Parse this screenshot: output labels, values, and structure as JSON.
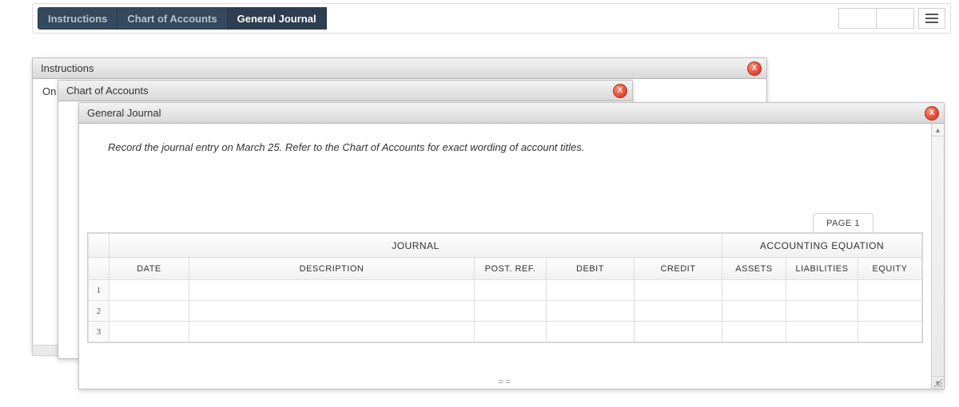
{
  "toolbar": {
    "tabs": [
      {
        "label": "Instructions",
        "active": false
      },
      {
        "label": "Chart of Accounts",
        "active": false
      },
      {
        "label": "General Journal",
        "active": true
      }
    ]
  },
  "panels": {
    "instructions": {
      "title": "Instructions",
      "body_prefix": "On"
    },
    "chart": {
      "title": "Chart of Accounts"
    },
    "journal": {
      "title": "General Journal"
    }
  },
  "journal": {
    "instruction": "Record the journal entry on March 25. Refer to the Chart of Accounts for exact wording of account titles.",
    "page_label": "PAGE 1",
    "group_headers": {
      "journal": "JOURNAL",
      "equation": "ACCOUNTING EQUATION"
    },
    "columns": {
      "date": "DATE",
      "description": "DESCRIPTION",
      "post_ref": "POST. REF.",
      "debit": "DEBIT",
      "credit": "CREDIT",
      "assets": "ASSETS",
      "liabilities": "LIABILITIES",
      "equity": "EQUITY"
    },
    "rows": [
      {
        "n": "1",
        "date": "",
        "description": "",
        "post_ref": "",
        "debit": "",
        "credit": "",
        "assets": "",
        "liabilities": "",
        "equity": ""
      },
      {
        "n": "2",
        "date": "",
        "description": "",
        "post_ref": "",
        "debit": "",
        "credit": "",
        "assets": "",
        "liabilities": "",
        "equity": ""
      },
      {
        "n": "3",
        "date": "",
        "description": "",
        "post_ref": "",
        "debit": "",
        "credit": "",
        "assets": "",
        "liabilities": "",
        "equity": ""
      }
    ]
  },
  "close_glyph": "X"
}
